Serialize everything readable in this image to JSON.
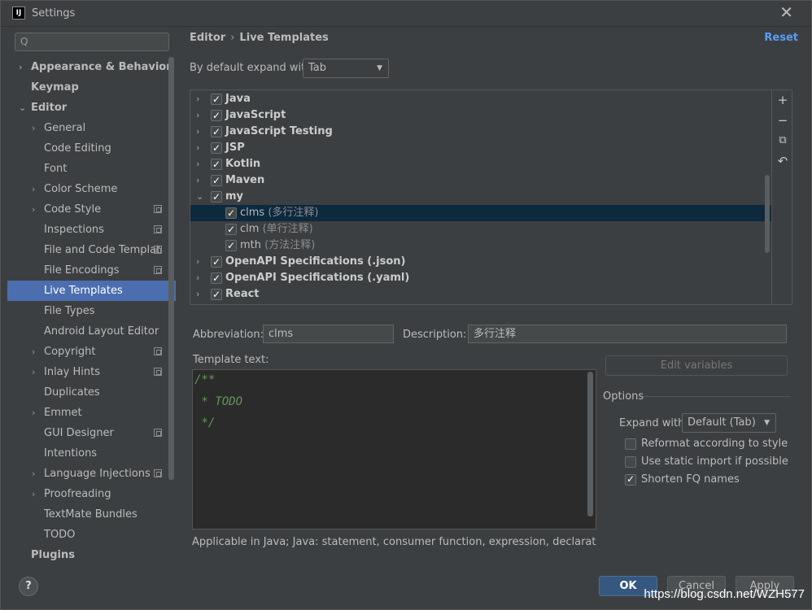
{
  "window": {
    "title": "Settings",
    "app_icon": "IJ",
    "close_glyph": "✕"
  },
  "sidebar": {
    "search_glyph": "Q",
    "items": [
      {
        "label": "Appearance & Behavior",
        "bold": true,
        "level": 0,
        "arrow": "›"
      },
      {
        "label": "Keymap",
        "bold": true,
        "level": 0,
        "arrow": ""
      },
      {
        "label": "Editor",
        "bold": true,
        "level": 0,
        "arrow": "⌄"
      },
      {
        "label": "General",
        "level": 1,
        "arrow": "›"
      },
      {
        "label": "Code Editing",
        "level": 1,
        "arrow": ""
      },
      {
        "label": "Font",
        "level": 1,
        "arrow": ""
      },
      {
        "label": "Color Scheme",
        "level": 1,
        "arrow": "›"
      },
      {
        "label": "Code Style",
        "level": 1,
        "arrow": "›",
        "proj": true
      },
      {
        "label": "Inspections",
        "level": 1,
        "arrow": "",
        "proj": true
      },
      {
        "label": "File and Code Templat",
        "level": 1,
        "arrow": "",
        "proj": true
      },
      {
        "label": "File Encodings",
        "level": 1,
        "arrow": "",
        "proj": true
      },
      {
        "label": "Live Templates",
        "level": 1,
        "arrow": "",
        "selected": true
      },
      {
        "label": "File Types",
        "level": 1,
        "arrow": ""
      },
      {
        "label": "Android Layout Editor",
        "level": 1,
        "arrow": ""
      },
      {
        "label": "Copyright",
        "level": 1,
        "arrow": "›",
        "proj": true
      },
      {
        "label": "Inlay Hints",
        "level": 1,
        "arrow": "›",
        "proj": true
      },
      {
        "label": "Duplicates",
        "level": 1,
        "arrow": ""
      },
      {
        "label": "Emmet",
        "level": 1,
        "arrow": "›"
      },
      {
        "label": "GUI Designer",
        "level": 1,
        "arrow": "",
        "proj": true
      },
      {
        "label": "Intentions",
        "level": 1,
        "arrow": ""
      },
      {
        "label": "Language Injections",
        "level": 1,
        "arrow": "›",
        "proj": true
      },
      {
        "label": "Proofreading",
        "level": 1,
        "arrow": "›"
      },
      {
        "label": "TextMate Bundles",
        "level": 1,
        "arrow": ""
      },
      {
        "label": "TODO",
        "level": 1,
        "arrow": ""
      },
      {
        "label": "Plugins",
        "bold": true,
        "level": 0,
        "arrow": ""
      }
    ]
  },
  "header": {
    "crumb_1": "Editor",
    "crumb_sep": "›",
    "crumb_2": "Live Templates",
    "reset": "Reset"
  },
  "expand": {
    "label": "By default expand with",
    "value": "Tab",
    "caret": "▼"
  },
  "templates": [
    {
      "name": "Java",
      "group": true,
      "checked": true,
      "arrow": "›"
    },
    {
      "name": "JavaScript",
      "group": true,
      "checked": true,
      "arrow": "›"
    },
    {
      "name": "JavaScript Testing",
      "group": true,
      "checked": true,
      "arrow": "›"
    },
    {
      "name": "JSP",
      "group": true,
      "checked": true,
      "arrow": "›"
    },
    {
      "name": "Kotlin",
      "group": true,
      "checked": true,
      "arrow": "›"
    },
    {
      "name": "Maven",
      "group": true,
      "checked": true,
      "arrow": "›"
    },
    {
      "name": "my",
      "group": true,
      "checked": true,
      "arrow": "⌄"
    },
    {
      "name": "clms",
      "desc": "(多行注释)",
      "group": false,
      "checked": true,
      "selected": true
    },
    {
      "name": "clm",
      "desc": "(单行注释)",
      "group": false,
      "checked": true
    },
    {
      "name": "mth",
      "desc": "(方法注释)",
      "group": false,
      "checked": true
    },
    {
      "name": "OpenAPI Specifications (.json)",
      "group": true,
      "checked": true,
      "arrow": "›"
    },
    {
      "name": "OpenAPI Specifications (.yaml)",
      "group": true,
      "checked": true,
      "arrow": "›"
    },
    {
      "name": "React",
      "group": true,
      "checked": true,
      "arrow": "›"
    }
  ],
  "tools": {
    "add": "+",
    "remove": "−",
    "copy": "⧉",
    "restore": "↶"
  },
  "form": {
    "abbreviation_label": "Abbreviation:",
    "abbreviation_value": "clms",
    "description_label": "Description:",
    "description_value": "多行注释",
    "template_text_label": "Template text:",
    "template_lines": [
      "/**",
      " * TODO",
      " */"
    ],
    "edit_variables": "Edit variables",
    "applicable": "Applicable in Java; Java: statement, consumer function, expression, declaration, comm"
  },
  "options": {
    "title": "Options",
    "expand_with_label": "Expand with",
    "expand_with_value": "Default (Tab)",
    "checks": [
      {
        "label": "Reformat according to style",
        "checked": false
      },
      {
        "label": "Use static import if possible",
        "checked": false
      },
      {
        "label": "Shorten FQ names",
        "checked": true
      }
    ]
  },
  "footer": {
    "help": "?",
    "ok": "OK",
    "cancel": "Cancel",
    "apply": "Apply",
    "watermark": "https://blog.csdn.net/WZH577"
  }
}
